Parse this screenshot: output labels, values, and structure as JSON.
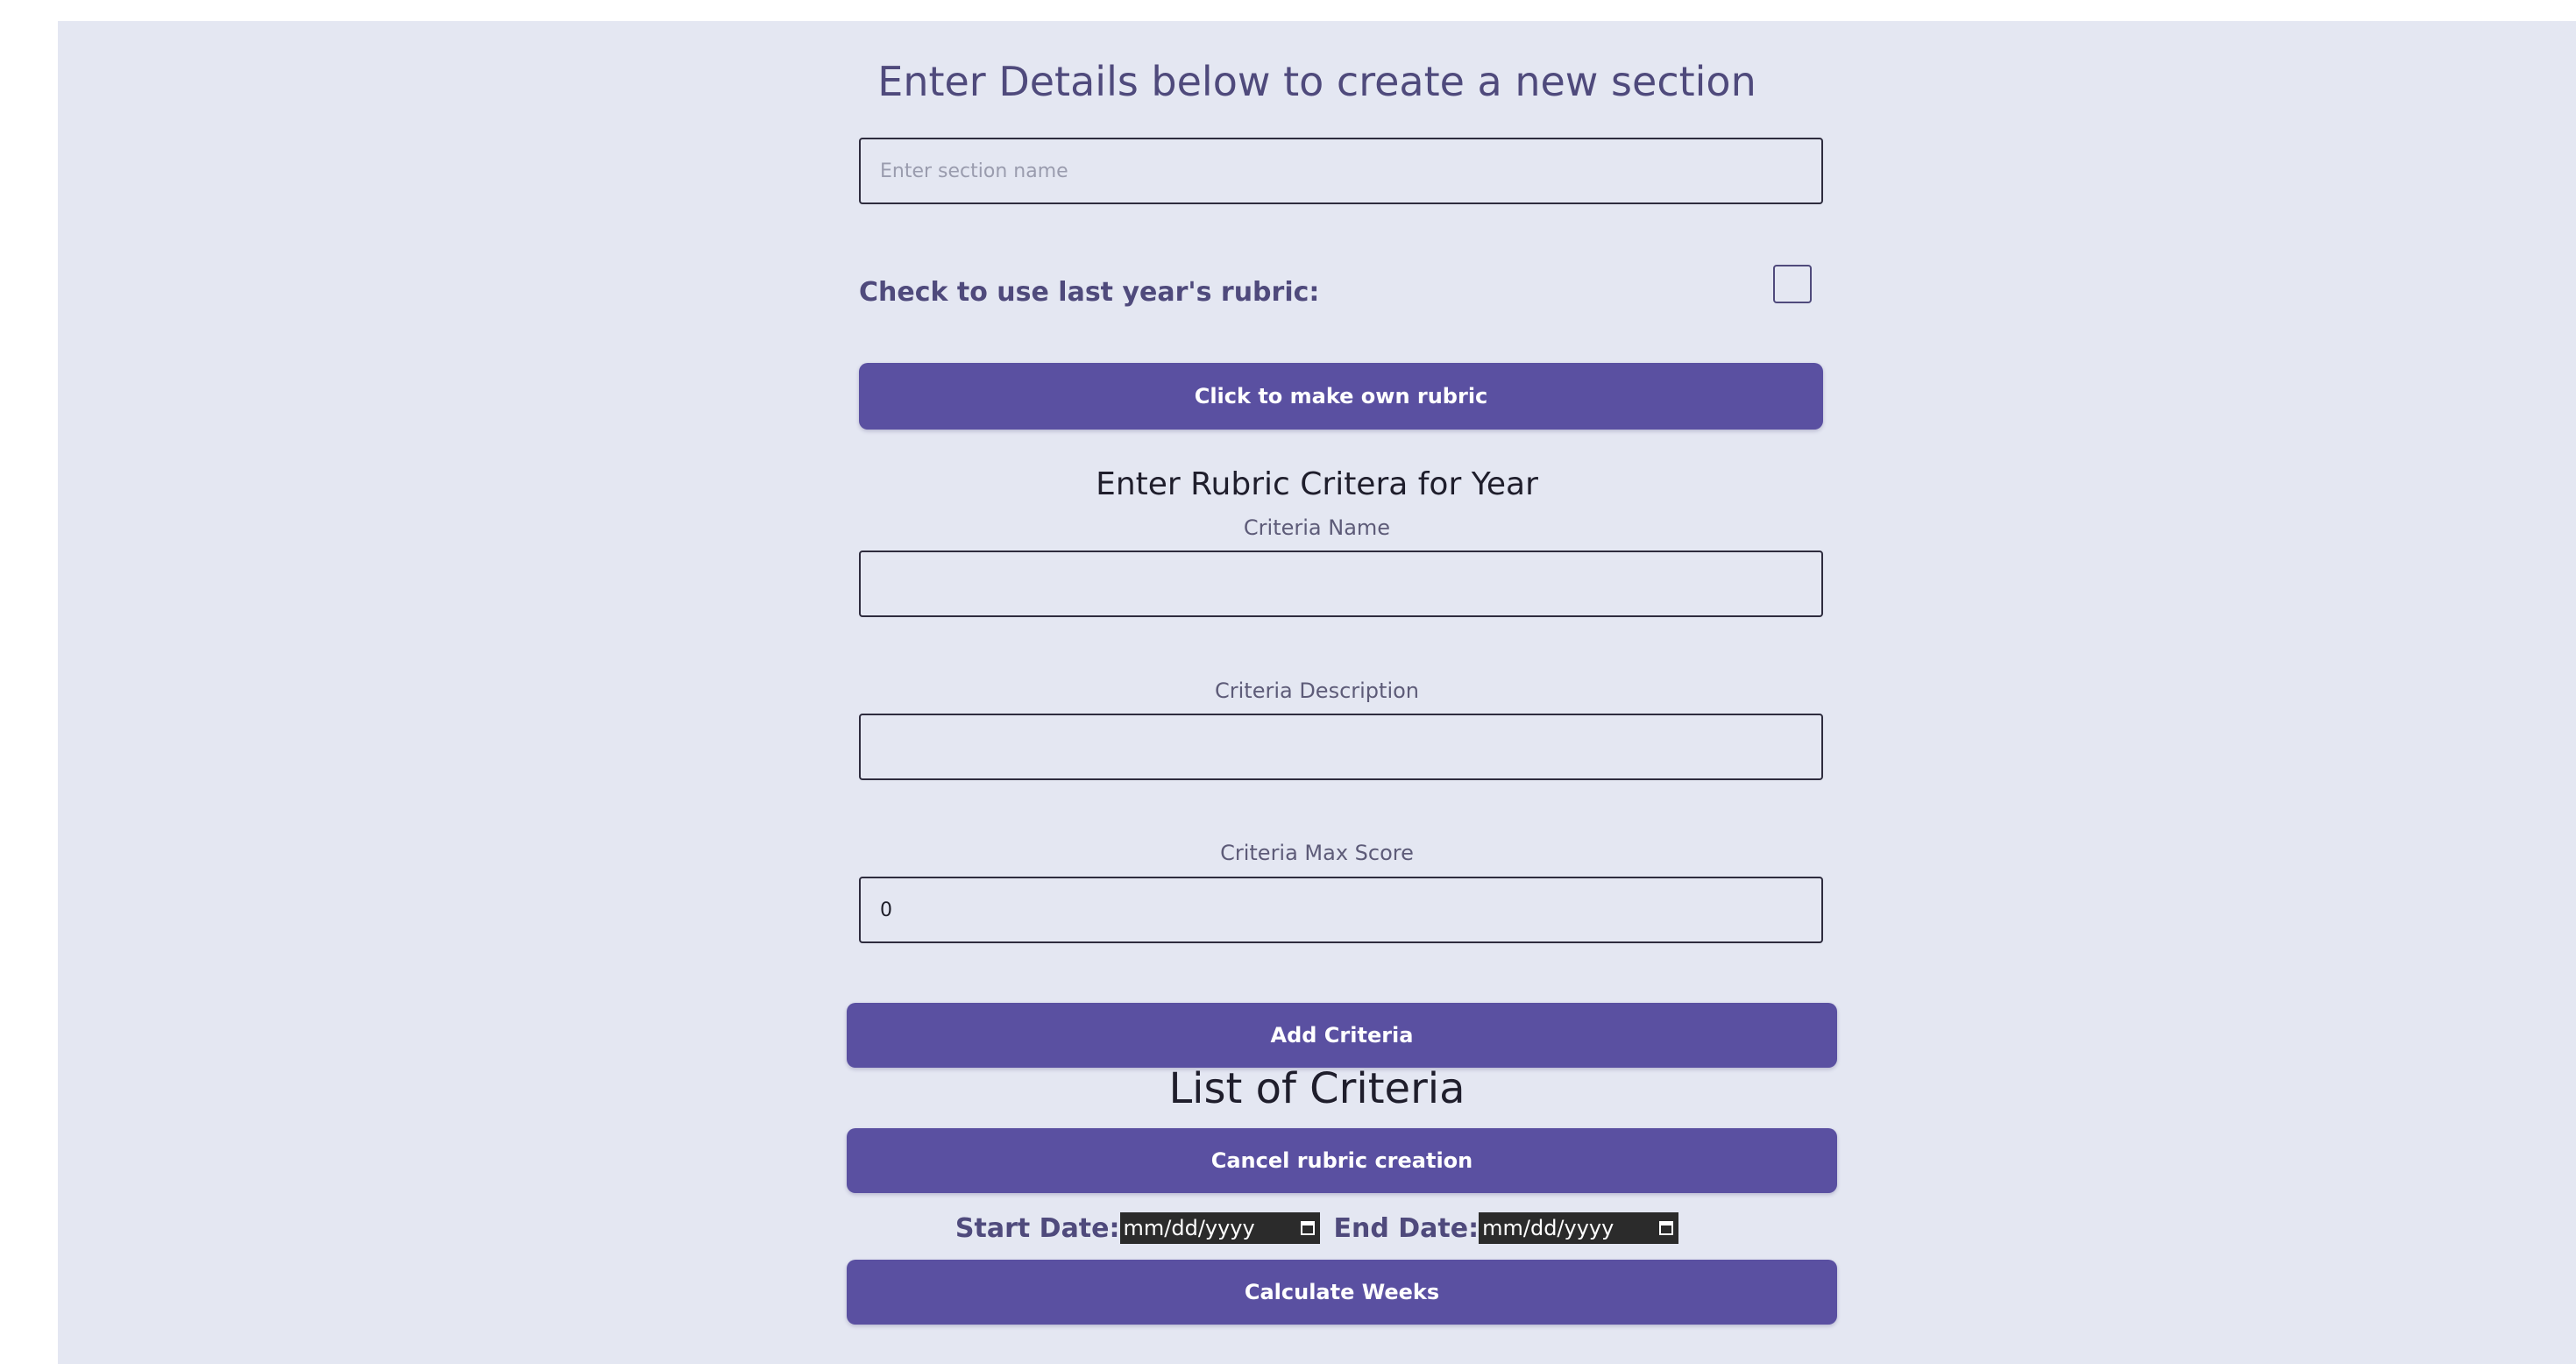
{
  "section": {
    "title": "Enter Details below to create a new section",
    "name_placeholder": "Enter section name",
    "name_value": ""
  },
  "rubric_reuse": {
    "label": "Check to use last year's rubric:",
    "checked": false
  },
  "make_rubric_button": "Click to make own rubric",
  "rubric_form": {
    "title": "Enter Rubric Critera for Year",
    "criteria_name_label": "Criteria Name",
    "criteria_name_value": "",
    "criteria_description_label": "Criteria Description",
    "criteria_description_value": "",
    "criteria_max_score_label": "Criteria Max Score",
    "criteria_max_score_value": "0",
    "add_button": "Add Criteria"
  },
  "criteria_list": {
    "title": "List of Criteria",
    "items": []
  },
  "cancel_button": "Cancel rubric creation",
  "dates": {
    "start_label": "Start Date:",
    "start_value": "mm/dd/yyyy",
    "end_label": "End Date:",
    "end_value": "mm/dd/yyyy"
  },
  "calculate_button": "Calculate Weeks",
  "colors": {
    "background": "#e4e7f2",
    "accent": "#5a50a1",
    "heading": "#4f4a7c"
  }
}
